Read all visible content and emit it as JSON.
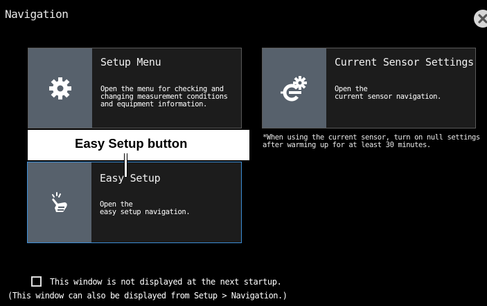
{
  "window": {
    "title": "Navigation",
    "close_icon": "close-icon"
  },
  "cards": {
    "setup_menu": {
      "title": "Setup Menu",
      "description": "Open the menu for checking and\nchanging measurement conditions\nand equipment information.",
      "icon": "gear-icon"
    },
    "current_sensor": {
      "title": "Current Sensor Settings",
      "description": "Open the\ncurrent sensor navigation.",
      "icon": "sensor-gear-icon"
    },
    "easy_setup": {
      "title": "Easy Setup",
      "description": "Open the\neasy setup navigation.",
      "icon": "pointing-hand-icon"
    }
  },
  "sensor_note": "*When using the current sensor, turn on null settings\nafter warming up for at least 30 minutes.",
  "callout": {
    "label": "Easy Setup button"
  },
  "startup_option": {
    "checked": false,
    "label": "This window is not displayed at the next startup."
  },
  "footnote": "(This window can also be displayed from Setup > Navigation.)",
  "colors": {
    "background": "#000000",
    "card_bg": "#1c1c1c",
    "icon_panel": "#57616c",
    "selected_border": "#3d8fd8"
  }
}
